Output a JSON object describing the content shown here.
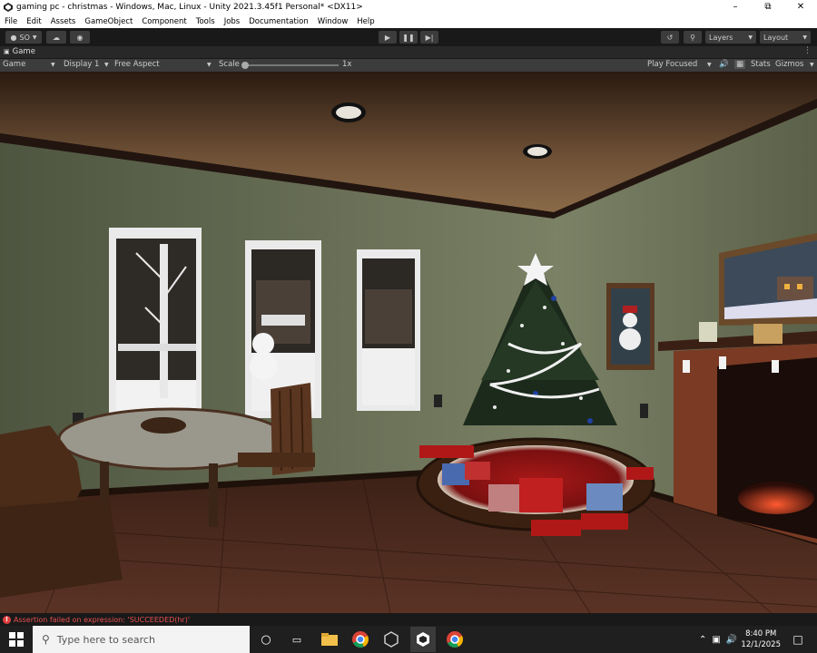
{
  "window": {
    "title": "gaming pc - christmas - Windows, Mac, Linux - Unity 2021.3.45f1 Personal* <DX11>"
  },
  "menu": [
    "File",
    "Edit",
    "Assets",
    "GameObject",
    "Component",
    "Tools",
    "Jobs",
    "Documentation",
    "Window",
    "Help"
  ],
  "toolbar": {
    "account_label": "SO",
    "layers_label": "Layers",
    "layout_label": "Layout"
  },
  "tab": {
    "label": "Game"
  },
  "gamebar": {
    "mode": "Game",
    "display": "Display 1",
    "aspect": "Free Aspect",
    "scale_label": "Scale",
    "scale_value": "1x",
    "play_mode": "Play Focused",
    "stats_label": "Stats",
    "gizmos_label": "Gizmos"
  },
  "status": {
    "error_text": "Assertion failed on expression: 'SUCCEEDED(hr)'"
  },
  "taskbar": {
    "search_placeholder": "Type here to search",
    "time": "8:40 PM",
    "date": "12/1/2025"
  },
  "colors": {
    "wall": "#6b7356",
    "floor": "#4a2a1c",
    "ceiling": "#6e5036",
    "error": "#e85050"
  }
}
